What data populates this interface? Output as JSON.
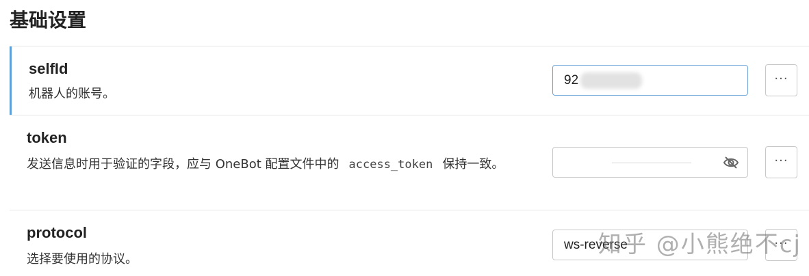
{
  "section": {
    "title": "基础设置"
  },
  "settings": [
    {
      "name": "selfId",
      "description": "机器人的账号。",
      "value": "92"
    },
    {
      "name": "token",
      "description_before": "发送信息时用于验证的字段，应与 OneBot 配置文件中的",
      "code": "access_token",
      "description_after": "保持一致。",
      "value": ""
    },
    {
      "name": "protocol",
      "description": "选择要使用的协议。",
      "value": "ws-reverse"
    }
  ],
  "more_label": "···",
  "icons": {
    "password_toggle": "eye-slash-icon"
  },
  "colors": {
    "accent": "#5d9fd6",
    "focus_border": "#6ea6d8"
  },
  "watermark": "知乎 @小熊绝不cj"
}
